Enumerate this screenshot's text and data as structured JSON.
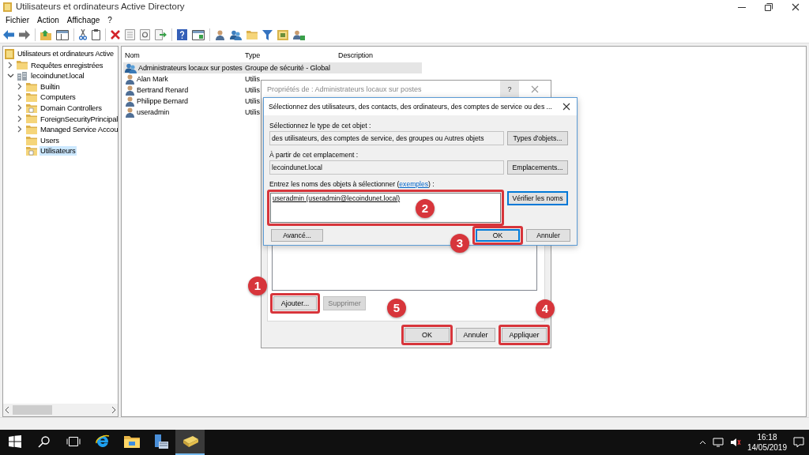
{
  "window": {
    "title": "Utilisateurs et ordinateurs Active Directory"
  },
  "menu": [
    "Fichier",
    "Action",
    "Affichage",
    "?"
  ],
  "tree": {
    "label": "Utilisateurs et ordinateurs Active",
    "kind": "ad",
    "selected": false,
    "children": [
      {
        "label": "Requêtes enregistrées",
        "kind": "folder",
        "expanded": false,
        "selected": false
      },
      {
        "label": "lecoindunet.local",
        "kind": "domain",
        "expanded": true,
        "selected": false,
        "children": [
          {
            "label": "Builtin",
            "kind": "folder",
            "expanded": false,
            "selected": false
          },
          {
            "label": "Computers",
            "kind": "folder",
            "expanded": false,
            "selected": false
          },
          {
            "label": "Domain Controllers",
            "kind": "ou",
            "expanded": false,
            "selected": false
          },
          {
            "label": "ForeignSecurityPrincipal",
            "kind": "folder",
            "expanded": false,
            "selected": false
          },
          {
            "label": "Managed Service Accou",
            "kind": "folder",
            "expanded": false,
            "selected": false
          },
          {
            "label": "Users",
            "kind": "folder",
            "selected": false
          },
          {
            "label": "Utilisateurs",
            "kind": "ou",
            "selected": true
          }
        ]
      }
    ]
  },
  "list": {
    "columns": [
      "Nom",
      "Type",
      "Description"
    ],
    "rows": [
      {
        "name": "Administrateurs locaux sur postes",
        "type": "Groupe de sécurité - Global",
        "kind": "group",
        "selected": true
      },
      {
        "name": "Alan Mark",
        "type": "Utilis",
        "kind": "user",
        "selected": false
      },
      {
        "name": "Bertrand Renard",
        "type": "Utilis",
        "kind": "user",
        "selected": false
      },
      {
        "name": "Philippe Bernard",
        "type": "Utilis",
        "kind": "user",
        "selected": false
      },
      {
        "name": "useradmin",
        "type": "Utilis",
        "kind": "user",
        "selected": false
      }
    ]
  },
  "properties_dialog": {
    "title": "Propriétés de : Administrateurs locaux sur postes",
    "help": "?",
    "member_buttons": [
      {
        "label": "Ajouter...",
        "disabled": false,
        "highlighted": true
      },
      {
        "label": "Supprimer",
        "disabled": true,
        "highlighted": false
      }
    ],
    "footer_buttons": [
      {
        "label": "OK",
        "highlighted": true
      },
      {
        "label": "Annuler",
        "highlighted": false
      },
      {
        "label": "Appliquer",
        "highlighted": true
      }
    ]
  },
  "select_dialog": {
    "title": "Sélectionnez des utilisateurs, des contacts, des ordinateurs, des comptes de service ou des ...",
    "object_type": {
      "label": "Sélectionnez le type de cet objet :",
      "value": "des utilisateurs, des comptes de service, des groupes ou Autres objets",
      "button": "Types d'objets..."
    },
    "location": {
      "label": "À partir de cet emplacement :",
      "value": "lecoindunet.local",
      "button": "Emplacements..."
    },
    "names": {
      "label_before": "Entrez les noms des objets à sélectionner (",
      "link": "exemples",
      "label_after": ") :",
      "value": "useradmin (useradmin@lecoindunet.local)",
      "highlighted": true,
      "button": "Vérifier les noms"
    },
    "footer_buttons": [
      {
        "label": "Avancé...",
        "default": false,
        "highlighted": false
      },
      {
        "label": "OK",
        "default": true,
        "highlighted": true
      },
      {
        "label": "Annuler",
        "default": false,
        "highlighted": false
      }
    ]
  },
  "callouts": [
    {
      "number": "1"
    },
    {
      "number": "2"
    },
    {
      "number": "3"
    },
    {
      "number": "4"
    },
    {
      "number": "5"
    }
  ],
  "taskbar": {
    "apps": [
      {
        "kind": "start",
        "active": false
      },
      {
        "kind": "search",
        "active": false
      },
      {
        "kind": "taskview",
        "active": false
      },
      {
        "kind": "browser",
        "active": false
      },
      {
        "kind": "explorer",
        "active": false
      },
      {
        "kind": "server",
        "active": false
      },
      {
        "kind": "directory",
        "active": true
      }
    ],
    "time": "16:18",
    "date": "14/05/2019"
  }
}
